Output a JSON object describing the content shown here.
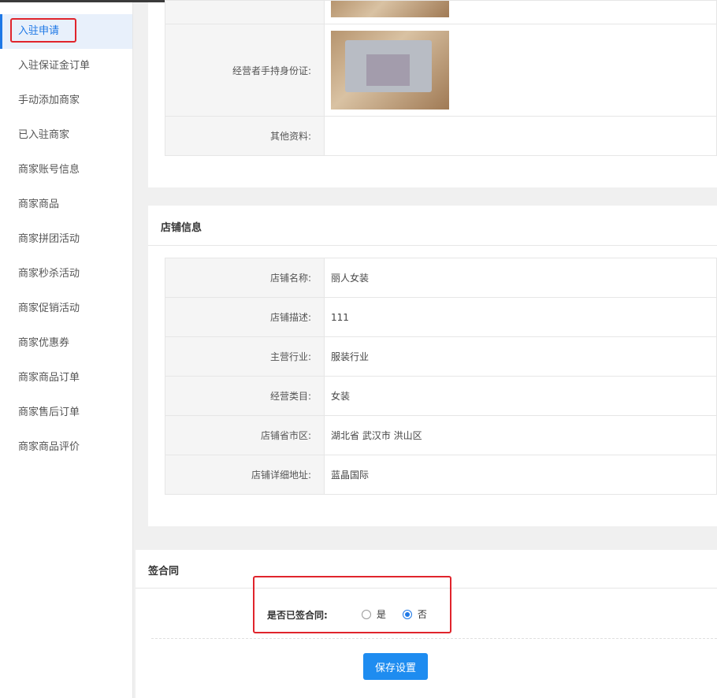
{
  "sidebar": {
    "items": [
      {
        "label": "入驻申请"
      },
      {
        "label": "入驻保证金订单"
      },
      {
        "label": "手动添加商家"
      },
      {
        "label": "已入驻商家"
      },
      {
        "label": "商家账号信息"
      },
      {
        "label": "商家商品"
      },
      {
        "label": "商家拼团活动"
      },
      {
        "label": "商家秒杀活动"
      },
      {
        "label": "商家促销活动"
      },
      {
        "label": "商家优惠券"
      },
      {
        "label": "商家商品订单"
      },
      {
        "label": "商家售后订单"
      },
      {
        "label": "商家商品评价"
      }
    ],
    "active_index": 0
  },
  "personal": {
    "rows": [
      {
        "label": "经营者手持身份证:"
      },
      {
        "label": "其他资料:",
        "value": ""
      }
    ]
  },
  "shop": {
    "title": "店铺信息",
    "rows": [
      {
        "label": "店铺名称:",
        "value": "丽人女装"
      },
      {
        "label": "店铺描述:",
        "value": "111"
      },
      {
        "label": "主营行业:",
        "value": "服装行业"
      },
      {
        "label": "经营类目:",
        "value": "女装"
      },
      {
        "label": "店铺省市区:",
        "value": "湖北省 武汉市 洪山区"
      },
      {
        "label": "店铺详细地址:",
        "value": "蓝晶国际"
      }
    ]
  },
  "contract": {
    "title": "签合同",
    "question": "是否已签合同:",
    "options": [
      {
        "label": "是",
        "checked": false
      },
      {
        "label": "否",
        "checked": true
      }
    ],
    "save_label": "保存设置"
  },
  "colors": {
    "accent": "#1e78e6",
    "highlight": "#e0242c"
  }
}
